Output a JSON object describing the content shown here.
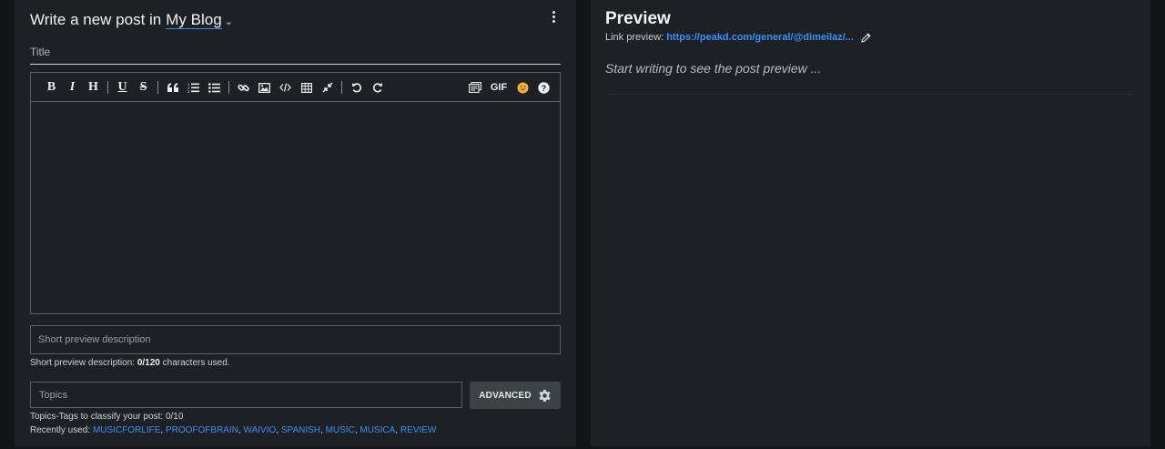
{
  "editor": {
    "header_prefix": "Write a new post in",
    "blog_name": "My Blog",
    "title_placeholder": "Title",
    "description_placeholder": "Short preview description",
    "description_help_prefix": "Short preview description:",
    "description_count": "0/120",
    "description_help_suffix": "characters used.",
    "topics_placeholder": "Topics",
    "advanced_label": "ADVANCED",
    "topics_help": "Topics-Tags to classify your post: 0/10",
    "recently_used_label": "Recently used:",
    "recent_topics": [
      "MUSICFORLIFE",
      "PROOFOFBRAIN",
      "WAIVIO",
      "SPANISH",
      "MUSIC",
      "MUSICA",
      "REVIEW"
    ]
  },
  "toolbar": {
    "bold_label": "B",
    "italic_label": "I",
    "heading_label": "H",
    "underline_label": "U",
    "strike_label": "S",
    "gif_label": "GIF"
  },
  "preview": {
    "title": "Preview",
    "link_label": "Link preview:",
    "link_url": "https://peakd.com/general/@dimeilaz/...",
    "placeholder": "Start writing to see the post preview ..."
  },
  "icons": [
    "chevron-down-icon",
    "more-vertical-icon",
    "quote-icon",
    "ordered-list-icon",
    "bullet-list-icon",
    "link-icon",
    "image-icon",
    "code-icon",
    "table-icon",
    "collapse-icon",
    "undo-icon",
    "redo-icon",
    "snippets-icon",
    "emoji-icon",
    "help-icon",
    "gear-icon",
    "pencil-icon"
  ],
  "colors": {
    "accent": "#3a91f5",
    "panel": "#1d2024",
    "background": "#131417"
  }
}
